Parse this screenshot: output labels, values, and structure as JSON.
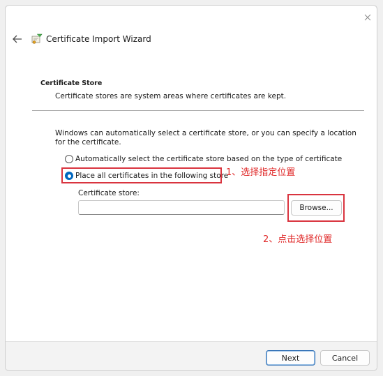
{
  "window": {
    "title": "Certificate Import Wizard",
    "close_icon": "close-icon",
    "back_icon": "back-arrow-icon",
    "app_icon": "certificate-icon"
  },
  "section": {
    "title": "Certificate Store",
    "description": "Certificate stores are system areas where certificates are kept."
  },
  "intro_text": "Windows can automatically select a certificate store, or you can specify a location for the certificate.",
  "options": [
    {
      "label": "Automatically select the certificate store based on the type of certificate",
      "checked": false
    },
    {
      "label": "Place all certificates in the following store",
      "checked": true
    }
  ],
  "store": {
    "label": "Certificate store:",
    "value": "",
    "browse_label": "Browse..."
  },
  "annotations": {
    "step1": "1、选择指定位置",
    "step2": "2、点击选择位置",
    "color": "#d9343f"
  },
  "footer": {
    "next_label": "Next",
    "cancel_label": "Cancel"
  },
  "colors": {
    "accent": "#0067c0",
    "annotation_red": "#e02a2a"
  }
}
